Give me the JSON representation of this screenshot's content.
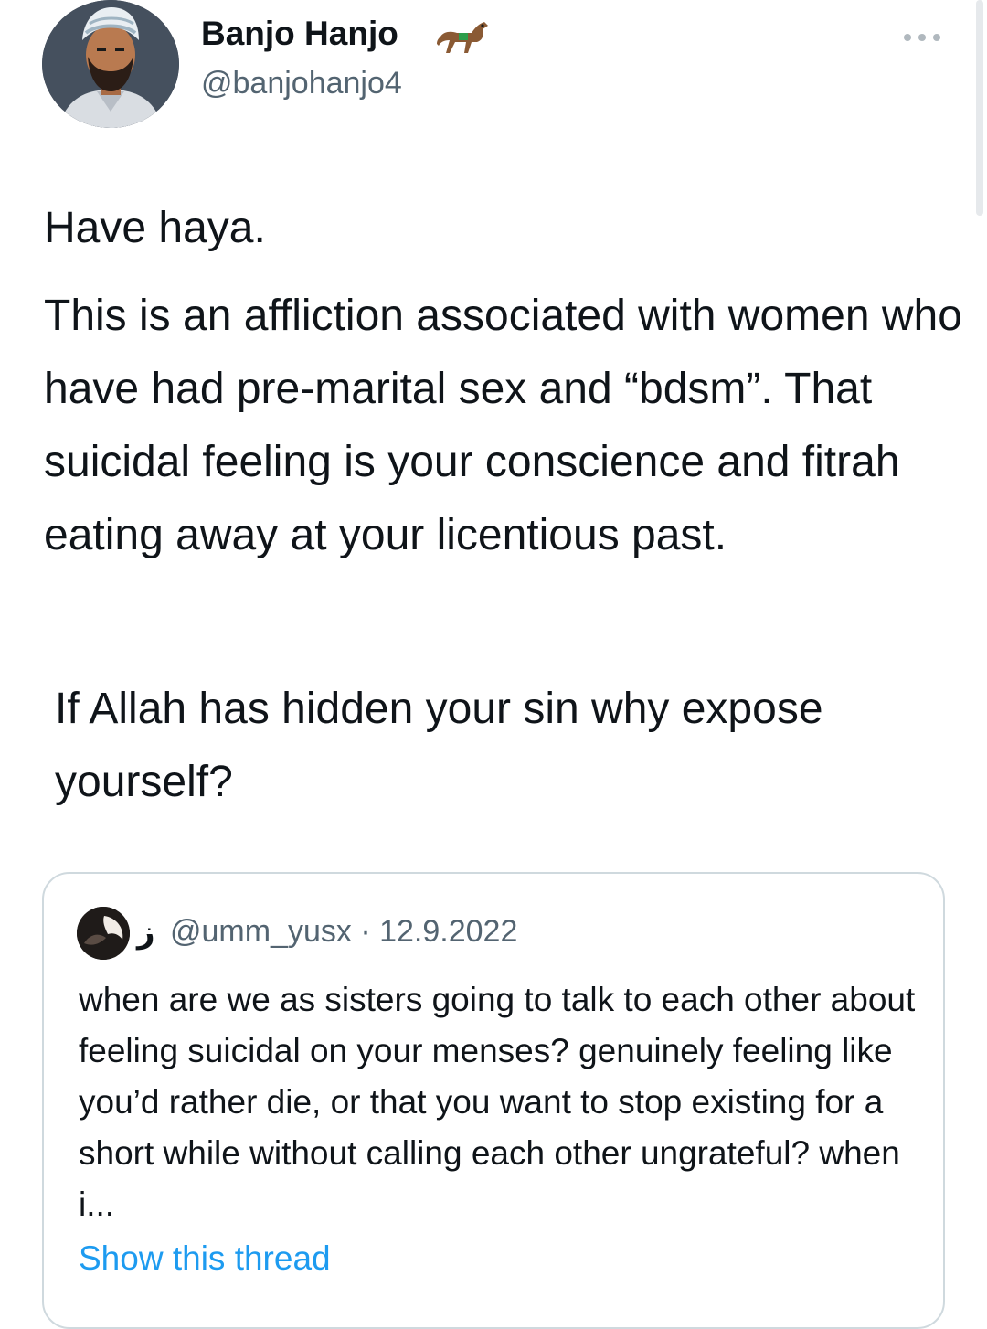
{
  "tweet": {
    "author": {
      "display_name": "Banjo Hanjo",
      "handle": "@banjohanjo4",
      "name_emoji": "horse-emoji"
    },
    "more_icon": "more-dots-icon",
    "paragraphs": [
      "Have haya.",
      "This is an affliction associated with women who have had pre-marital sex and “bdsm”. That suicidal feeling is your conscience and fitrah eating away at your licentious past.",
      "If Allah has hidden your sin why expose yourself?"
    ]
  },
  "quoted_tweet": {
    "display_name": "ز",
    "handle_date": "@umm_yusx · 12.9.2022",
    "text": "when are we as sisters going to talk to each other about feeling suicidal on your menses? genuinely feeling like you’d rather die, or that you want to stop existing for a short while without calling each other ungrateful? when i...",
    "show_thread_label": "Show this thread"
  },
  "colors": {
    "text_primary": "#0f1419",
    "text_secondary": "#536471",
    "link": "#1d9bf0",
    "card_border": "#cfd9de"
  }
}
